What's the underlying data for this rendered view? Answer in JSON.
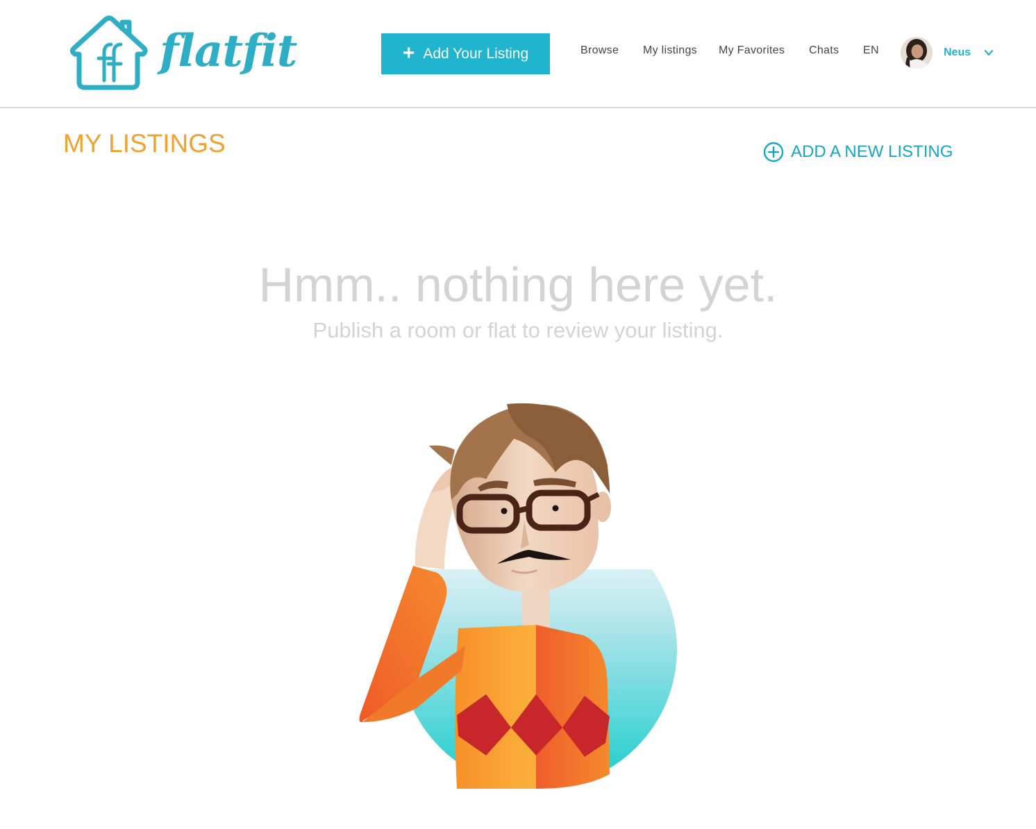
{
  "app": {
    "logo_text": "flatfit",
    "brand_color": "#20b4cf",
    "accent_color": "#f1a130"
  },
  "header": {
    "add_listing_button": {
      "icon": "plus-icon",
      "label": "Add Your Listing"
    },
    "nav": {
      "browse": "Browse",
      "my_listings": "My listings",
      "my_favorites": "My Favorites",
      "chats": "Chats",
      "language": "EN"
    },
    "user": {
      "name": "Neus",
      "avatar_icon": "avatar",
      "menu_icon": "chevron-down-icon"
    }
  },
  "main": {
    "title": "MY LISTINGS",
    "add_new_listing": {
      "icon": "circle-plus-icon",
      "label": "ADD A NEW LISTING"
    },
    "empty_state": {
      "title": "Hmm.. nothing here yet.",
      "subtitle": "Publish a room or flat to review your listing.",
      "illustration": "confused-man-illustration"
    }
  }
}
